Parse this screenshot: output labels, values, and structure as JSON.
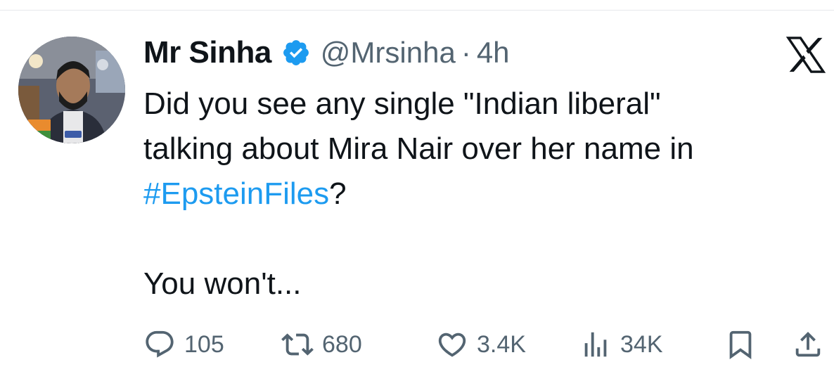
{
  "tweet": {
    "author_name": "Mr Sinha",
    "handle": "@Mrsinha",
    "separator": "·",
    "time": "4h",
    "verified_color": "#1d9bf0",
    "text_lines": [
      "Did you see any single \"Indian liberal\"",
      "talking about Mira Nair over her name in"
    ],
    "hashtag": "#EpsteinFiles",
    "hashtag_suffix": "?",
    "closing_line": "You won't...",
    "hashtag_color": "#1d9bf0"
  },
  "brand": {
    "logo_icon": "x-logo-icon"
  },
  "actions": {
    "replies": {
      "icon": "reply-icon",
      "count": "105"
    },
    "reposts": {
      "icon": "repost-icon",
      "count": "680"
    },
    "likes": {
      "icon": "heart-icon",
      "count": "3.4K"
    },
    "views": {
      "icon": "views-icon",
      "count": "34K"
    },
    "bookmark": {
      "icon": "bookmark-icon"
    },
    "share": {
      "icon": "share-icon"
    }
  }
}
